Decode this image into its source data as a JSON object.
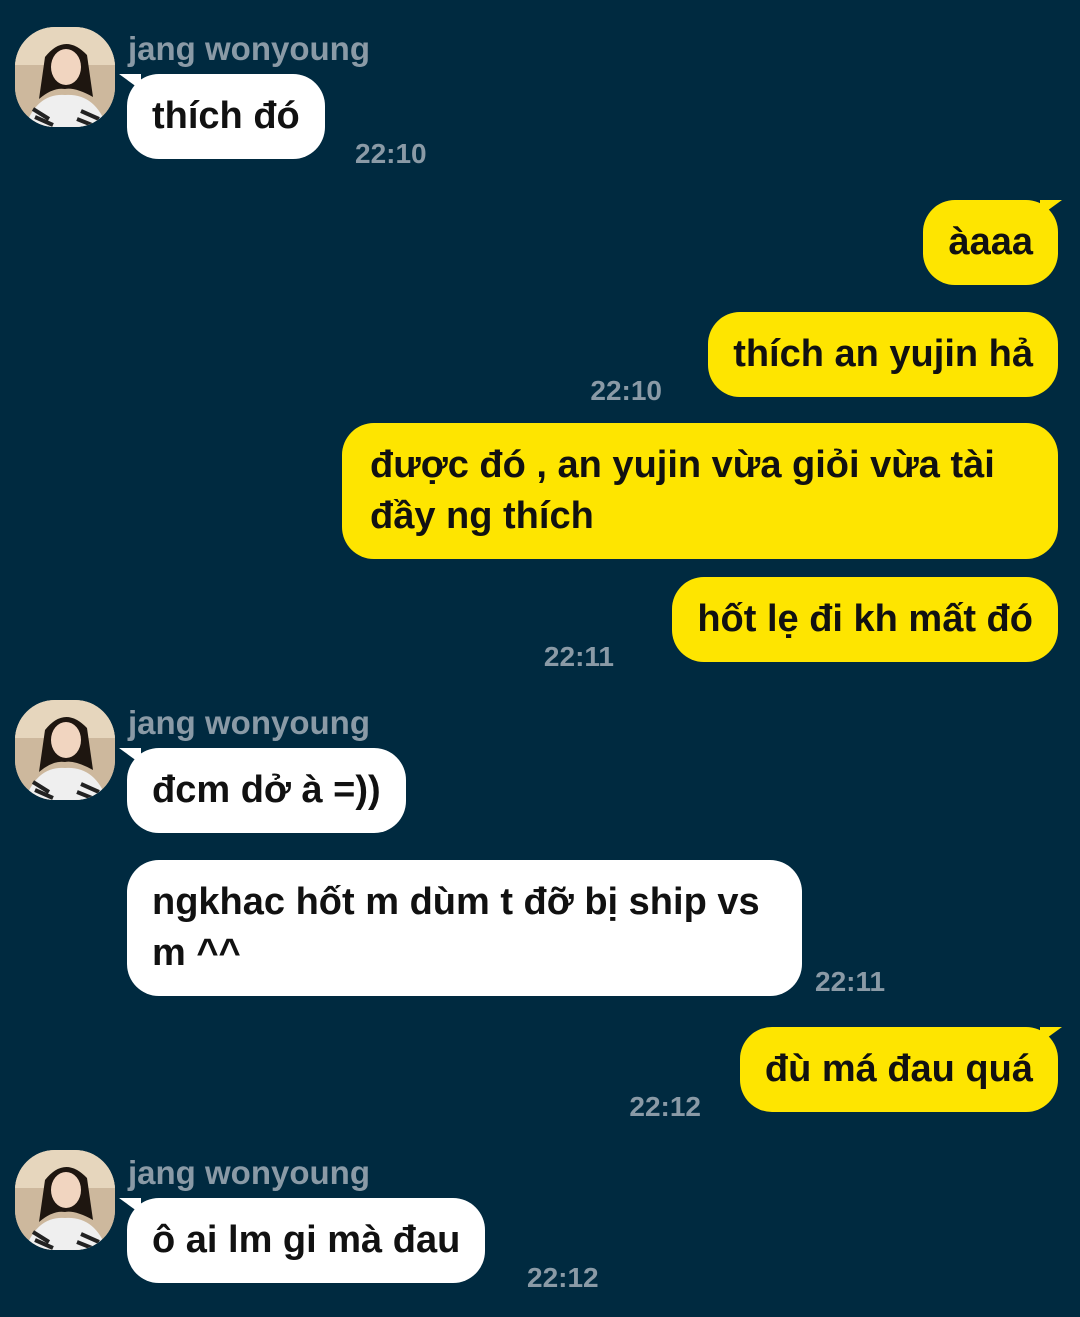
{
  "contact": {
    "name": "jang wonyoung",
    "avatar_icon": "profile-photo"
  },
  "colors": {
    "background": "#002a40",
    "incoming_bubble": "#ffffff",
    "outgoing_bubble": "#fee500",
    "meta_text": "#8a9aa6"
  },
  "messages": [
    {
      "direction": "incoming",
      "text": "thích đó",
      "time": "22:10"
    },
    {
      "direction": "outgoing",
      "text": "àaaa",
      "time": ""
    },
    {
      "direction": "outgoing",
      "text": "thích an yujin hả",
      "time": "22:10"
    },
    {
      "direction": "outgoing",
      "text": "được đó , an yujin vừa giỏi vừa tài đầy ng thích",
      "time": ""
    },
    {
      "direction": "outgoing",
      "text": "hốt lẹ đi kh mất đó",
      "time": "22:11"
    },
    {
      "direction": "incoming",
      "text": "đcm dở à =))",
      "time": ""
    },
    {
      "direction": "incoming",
      "text": "ngkhac hốt m dùm t đỡ bị ship vs m ^^",
      "time": "22:11"
    },
    {
      "direction": "outgoing",
      "text": "đù má đau quá",
      "time": "22:12"
    },
    {
      "direction": "incoming",
      "text": "ô ai lm gi mà đau",
      "time": "22:12"
    }
  ]
}
